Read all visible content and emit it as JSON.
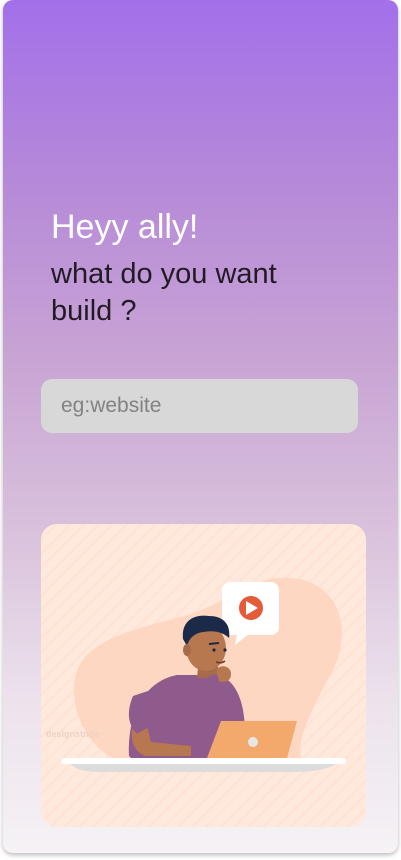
{
  "greeting": {
    "title": "Heyy ally!"
  },
  "prompt": {
    "question": "what do  you want\nbuild ?"
  },
  "search": {
    "placeholder": "eg:website"
  },
  "illustration": {
    "description_icon": "person-with-laptop-illustration",
    "watermark": "designstride",
    "colors": {
      "card_bg": "#ffe9dc",
      "blob": "#fdd9c4",
      "shirt": "#8f5a8c",
      "laptop": "#f2a96b",
      "play": "#e55a3b"
    }
  },
  "colors": {
    "gradient_top": "#a370e9",
    "gradient_bottom": "#f6f2f6",
    "title_text": "#ffffff",
    "question_text": "#221b26",
    "input_bg": "#d8d8d8"
  }
}
